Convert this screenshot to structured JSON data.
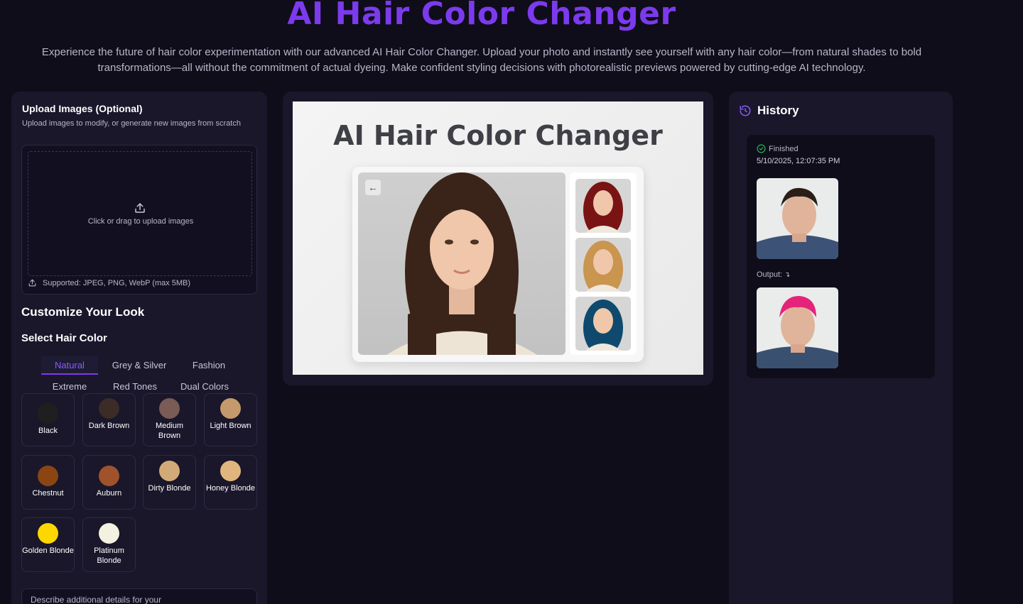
{
  "header": {
    "title": "AI Hair Color Changer",
    "description": "Experience the future of hair color experimentation with our advanced AI Hair Color Changer. Upload your photo and instantly see yourself with any hair color—from natural shades to bold transformations—all without the commitment of actual dyeing. Make confident styling decisions with photorealistic previews powered by cutting-edge AI technology."
  },
  "upload": {
    "title": "Upload Images (Optional)",
    "subtitle": "Upload images to modify, or generate new images from scratch",
    "hint": "Click or drag to upload images",
    "supported": "Supported: JPEG, PNG, WebP (max 5MB)"
  },
  "customize": {
    "title": "Customize Your Look",
    "select_title": "Select Hair Color",
    "tabs": [
      "Natural",
      "Grey & Silver",
      "Fashion",
      "Extreme",
      "Red Tones",
      "Dual Colors"
    ],
    "active_tab": "Natural",
    "swatches": [
      {
        "label": "Black",
        "color": "#1f1f1f"
      },
      {
        "label": "Dark Brown",
        "color": "#3b2c28"
      },
      {
        "label": "Medium Brown",
        "color": "#7a5b55"
      },
      {
        "label": "Light Brown",
        "color": "#c49a6c"
      },
      {
        "label": "Chestnut",
        "color": "#8b4513"
      },
      {
        "label": "Auburn",
        "color": "#a0522d"
      },
      {
        "label": "Dirty Blonde",
        "color": "#d2aa78"
      },
      {
        "label": "Honey Blonde",
        "color": "#e1b67e"
      },
      {
        "label": "Golden Blonde",
        "color": "#ffd700"
      },
      {
        "label": "Platinum Blonde",
        "color": "#f4f1e1"
      }
    ],
    "details_placeholder": "Describe additional details for your"
  },
  "preview": {
    "title": "AI Hair Color Changer",
    "back_icon": "arrow-left-icon"
  },
  "history": {
    "title": "History",
    "status": "Finished",
    "timestamp": "5/10/2025, 12:07:35 PM",
    "output_label": "Output:"
  },
  "colors": {
    "accent": "#7c3aed",
    "background": "#0f0d1a",
    "panel": "#1a172b",
    "success": "#22c55e"
  }
}
